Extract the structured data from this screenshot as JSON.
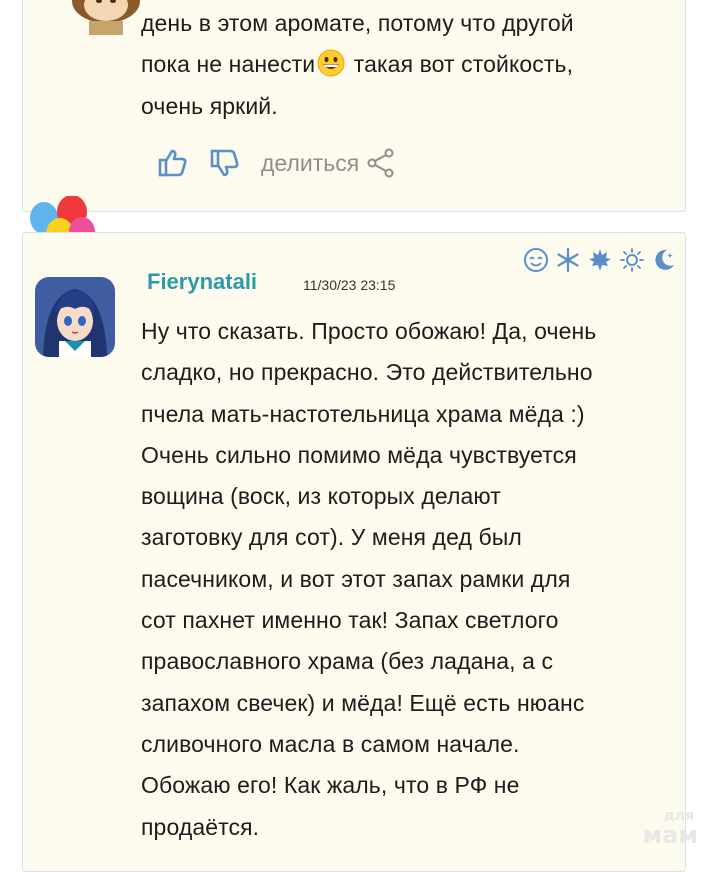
{
  "review1": {
    "text": "день в этом аромате, потому что другой\nпока не нанести",
    "text_after_emoji": " такая вот стойкость,\nочень яркий.",
    "emoji": "grinning-face-icon"
  },
  "actions": {
    "like_icon": "thumbs-up-icon",
    "dislike_icon": "thumbs-down-icon",
    "share_label": "делиться",
    "share_icon": "share-icon"
  },
  "review2": {
    "username": "Fierynatali",
    "timestamp": "11/30/23 23:15",
    "mood_icons": [
      "smile-face-icon",
      "snowflake-icon",
      "maple-leaf-icon",
      "sun-icon",
      "moon-star-icon"
    ],
    "text": "Ну что сказать. Просто обожаю! Да, очень\nсладко, но прекрасно. Это действительно\nпчела мать-настотельница храма мёда :)\nОчень сильно помимо мёда чувствуется\nвощина (воск, из которых делают\nзаготовку для сот). У меня дед был\nпасечником, и вот этот запах рамки для\nсот пахнет именно так! Запах светлого\nправославного храма (без ладана, а с\nзапахом свечек) и мёда! Ещё есть нюанс\nсливочного масла в самом начале.\nОбожаю его! Как жаль, что в РФ не\nпродаётся."
  },
  "watermark": {
    "small": "для",
    "big": "мам"
  },
  "colors": {
    "card_bg": "#fdfbee",
    "card_border": "#d4e3ee",
    "username": "#2d9aa8",
    "icon_blue": "#5a8fc9"
  }
}
